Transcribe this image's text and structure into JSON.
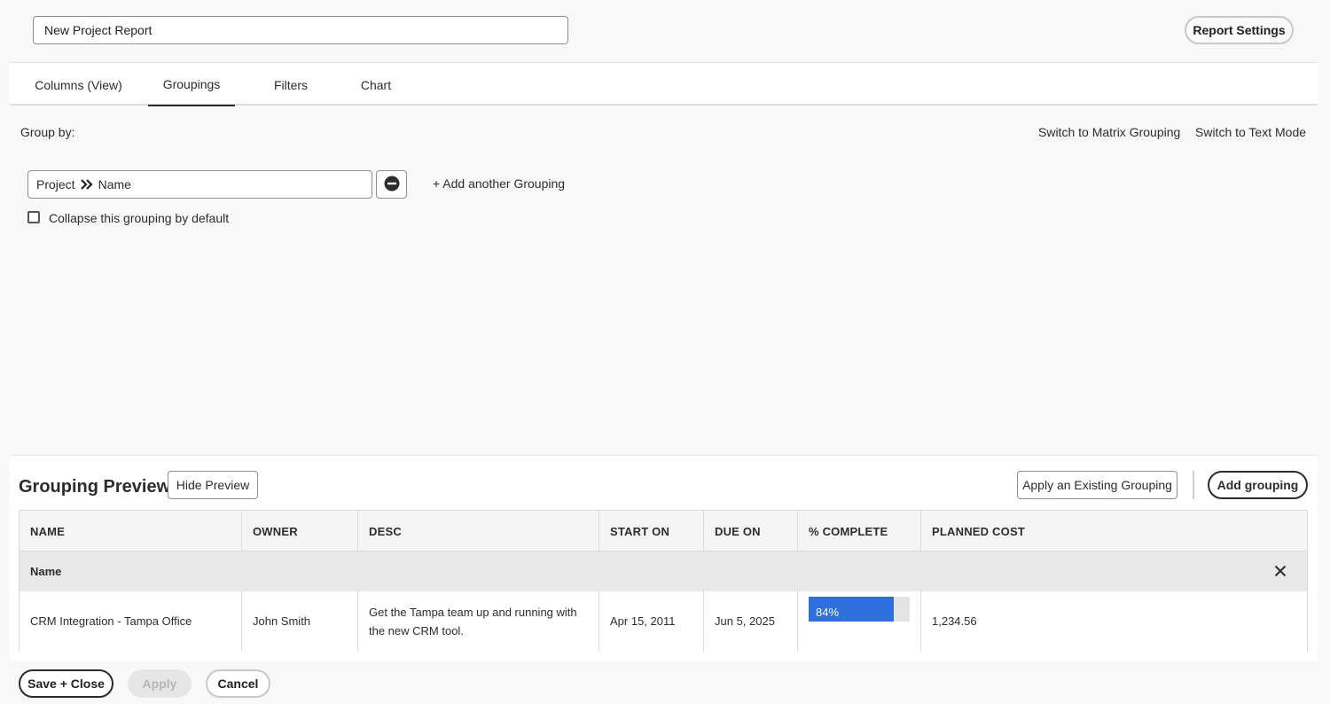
{
  "header": {
    "report_title": "New Project Report",
    "report_settings_label": "Report Settings"
  },
  "tabs": [
    {
      "label": "Columns (View)",
      "active": false
    },
    {
      "label": "Groupings",
      "active": true
    },
    {
      "label": "Filters",
      "active": false
    },
    {
      "label": "Chart",
      "active": false
    }
  ],
  "groupings": {
    "group_by_label": "Group by:",
    "switch_matrix_label": "Switch to Matrix Grouping",
    "switch_text_label": "Switch to Text Mode",
    "field_object": "Project",
    "field_name": "Name",
    "add_another_label": "+ Add another Grouping",
    "collapse_label": "Collapse this grouping by default",
    "collapse_checked": false
  },
  "preview": {
    "title": "Grouping Preview",
    "hide_preview_label": "Hide Preview",
    "apply_existing_label": "Apply an Existing Grouping",
    "add_grouping_label": "Add grouping",
    "columns": [
      "NAME",
      "OWNER",
      "DESC",
      "START ON",
      "DUE ON",
      "% COMPLETE",
      "PLANNED COST"
    ],
    "group_label": "Name",
    "rows": [
      {
        "name": "CRM Integration - Tampa Office",
        "owner": "John Smith",
        "desc": "Get the Tampa team up and running with the new CRM tool.",
        "start_on": "Apr 15, 2011",
        "due_on": "Jun 5, 2025",
        "percent_complete_label": "84%",
        "percent_complete_value": 84,
        "planned_cost": "1,234.56"
      }
    ]
  },
  "footer": {
    "save_close_label": "Save + Close",
    "apply_label": "Apply",
    "cancel_label": "Cancel"
  },
  "colors": {
    "progress_fill": "#2e6fdb",
    "progress_track": "#e3e3e3",
    "page_background": "#f8f8f8"
  }
}
